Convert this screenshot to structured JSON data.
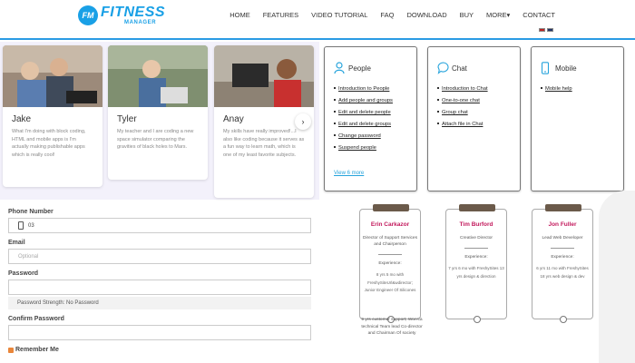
{
  "header": {
    "logo_badge": "FM",
    "logo_word": "FITNESS",
    "logo_sub": "MANAGER",
    "nav": [
      "HOME",
      "FEATURES",
      "VIDEO TUTORIAL",
      "FAQ",
      "DOWNLOAD",
      "BUY",
      "MORE▾",
      "CONTACT"
    ]
  },
  "testimonials": [
    {
      "name": "Jake",
      "quote": "What I'm doing with block coding, HTML and mobile apps is I'm actually making publishable apps which is really cool!"
    },
    {
      "name": "Tyler",
      "quote": "My teacher and I are coding a new space simulator comparing the gravities of black holes to Mars."
    },
    {
      "name": "Anay",
      "quote": "My skills have really improved!...I also like coding because it serves as a fun way to learn math, which is one of my least favorite subjects."
    }
  ],
  "help": {
    "people": {
      "title": "People",
      "links": [
        "Introduction to People",
        "Add people and groups",
        "Edit and delete people",
        "Edit and delete groups",
        "Change password",
        "Suspend people"
      ],
      "more": "View 6 more"
    },
    "chat": {
      "title": "Chat",
      "links": [
        "Introduction to Chat",
        "One-to-one chat",
        "Group chat",
        "Attach file in Chat"
      ]
    },
    "mobile": {
      "title": "Mobile",
      "links": [
        "Mobile help"
      ]
    }
  },
  "form": {
    "phone_label": "Phone Number",
    "phone_value": "03",
    "email_label": "Email",
    "email_placeholder": "Optional",
    "password_label": "Password",
    "strength": "Password Strength: No Password",
    "confirm_label": "Confirm Password",
    "remember_label": "Remember Me"
  },
  "team": [
    {
      "name": "Erin Carkazor",
      "role": "Director of Support Services and Chairperson",
      "exp_label": "Experience:",
      "exp": "8 yrs 5 mo with FreshySiteUrl&wdirector; Junior Engineer Of Silicones",
      "overflow": "9 yrs customer support; Won'ca technical Team lead Co-director and Chairman Of society"
    },
    {
      "name": "Tim Burford",
      "role": "Creative Director",
      "exp_label": "Experience:",
      "exp": "7 yrs 6 mo with FreshySites 13 yrs design & direction"
    },
    {
      "name": "Jon Fuller",
      "role": "Lead Web Developer",
      "exp_label": "Experience:",
      "exp": "6 yrs 11 mo with FreshySites 18 yrs web design & dev"
    }
  ]
}
